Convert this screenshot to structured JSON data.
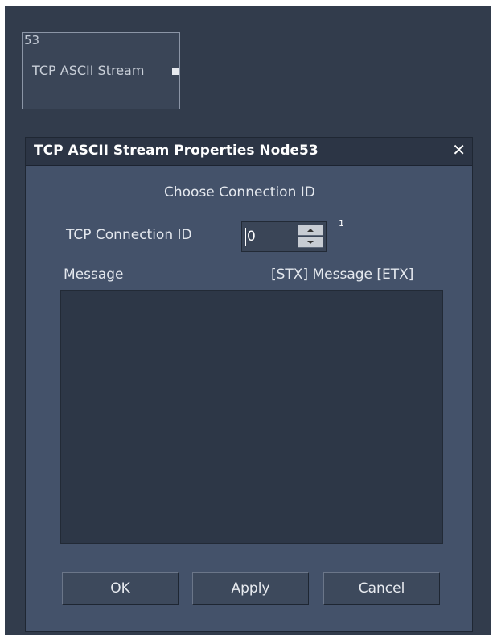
{
  "node": {
    "id": "53",
    "label": "TCP ASCII Stream"
  },
  "dialog": {
    "title": "TCP ASCII Stream Properties Node53",
    "close_icon": "close-icon",
    "heading": "Choose Connection ID",
    "connection_label": "TCP Connection ID",
    "connection_value": "0",
    "connection_max": "1",
    "message_label": "Message",
    "message_format": "[STX] Message [ETX]",
    "message_value": "",
    "buttons": {
      "ok": "OK",
      "apply": "Apply",
      "cancel": "Cancel"
    }
  }
}
